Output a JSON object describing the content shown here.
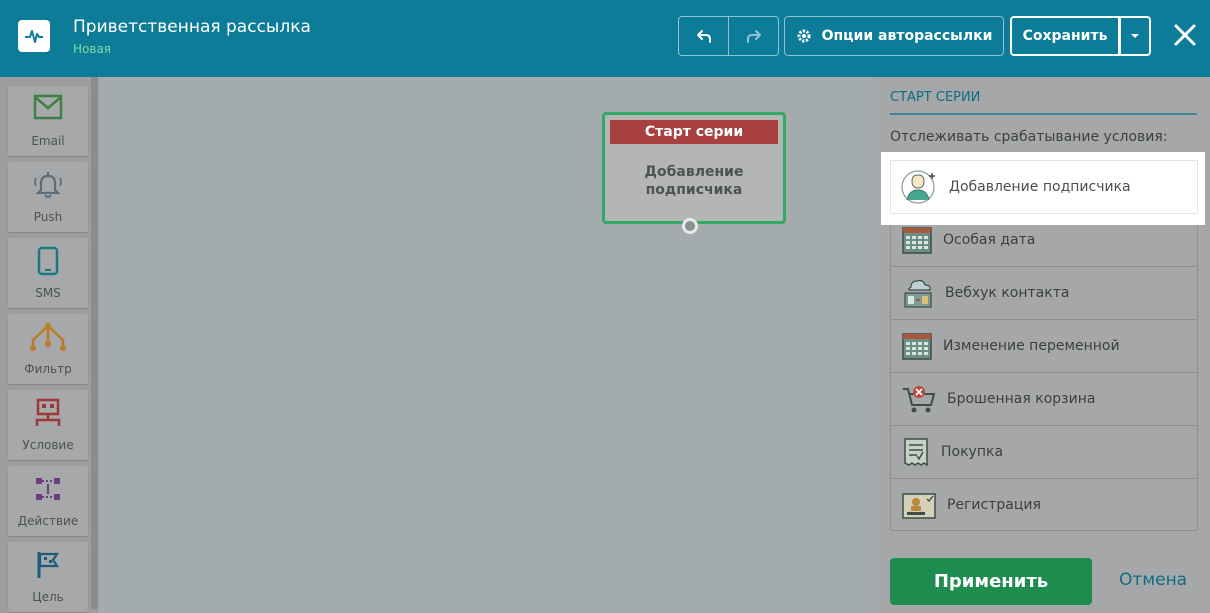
{
  "header": {
    "title": "Приветственная рассылка",
    "subtitle": "Новая",
    "options_label": "Опции авторассылки",
    "save_label": "Сохранить"
  },
  "toolbar": {
    "items": [
      {
        "label": "Email",
        "icon": "email-icon"
      },
      {
        "label": "Push",
        "icon": "bell-icon"
      },
      {
        "label": "SMS",
        "icon": "phone-icon"
      },
      {
        "label": "Фильтр",
        "icon": "filter-icon"
      },
      {
        "label": "Условие",
        "icon": "condition-icon"
      },
      {
        "label": "Действие",
        "icon": "action-icon"
      },
      {
        "label": "Цель",
        "icon": "goal-flag-icon"
      }
    ]
  },
  "node": {
    "header": "Старт серии",
    "body": "Добавление подписчика"
  },
  "panel": {
    "title": "СТАРТ СЕРИИ",
    "label": "Отслеживать срабатывание условия:",
    "items": [
      {
        "label": "Добавление подписчика",
        "icon": "add-subscriber-icon"
      },
      {
        "label": "Особая дата",
        "icon": "calendar-icon"
      },
      {
        "label": "Вебхук контакта",
        "icon": "webhook-icon"
      },
      {
        "label": "Изменение переменной",
        "icon": "calendar-grid-icon"
      },
      {
        "label": "Брошенная корзина",
        "icon": "abandoned-cart-icon"
      },
      {
        "label": "Покупка",
        "icon": "receipt-icon"
      },
      {
        "label": "Регистрация",
        "icon": "registration-icon"
      }
    ],
    "apply_label": "Применить",
    "cancel_label": "Отмена"
  },
  "colors": {
    "header_bg": "#0c7c98",
    "accent_green": "#1e8c4f",
    "node_red": "#a7403e"
  }
}
